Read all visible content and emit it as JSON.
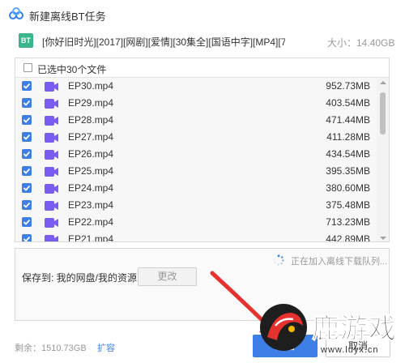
{
  "window": {
    "title": "新建离线BT任务"
  },
  "torrent": {
    "badge": "BT",
    "name": "[你好旧时光][2017][网剧][爱情][30集全][国语中字][MP4][7...",
    "size_text": "大小：14.40GB"
  },
  "list": {
    "select_all_label": "已选中30个文件",
    "rows": [
      {
        "name": "EP30.mp4",
        "size": "952.73MB",
        "checked": true
      },
      {
        "name": "EP29.mp4",
        "size": "403.54MB",
        "checked": true
      },
      {
        "name": "EP28.mp4",
        "size": "471.44MB",
        "checked": true
      },
      {
        "name": "EP27.mp4",
        "size": "411.28MB",
        "checked": true
      },
      {
        "name": "EP26.mp4",
        "size": "434.54MB",
        "checked": true
      },
      {
        "name": "EP25.mp4",
        "size": "395.35MB",
        "checked": true
      },
      {
        "name": "EP24.mp4",
        "size": "380.60MB",
        "checked": true
      },
      {
        "name": "EP23.mp4",
        "size": "375.48MB",
        "checked": true
      },
      {
        "name": "EP22.mp4",
        "size": "713.23MB",
        "checked": true
      },
      {
        "name": "EP21.mp4",
        "size": "442.89MB",
        "checked": true
      }
    ]
  },
  "save": {
    "status_text": "正在加入离线下载队列...",
    "location_label": "保存到: 我的网盘/我的资源",
    "change_label": "更改"
  },
  "footer": {
    "remaining_text": "剩余：1510.73GB",
    "expand_label": "扩容",
    "start_label": "开始",
    "cancel_label": "取消"
  },
  "watermark": {
    "brand": "鹿游戏",
    "url": "www.luyx.cn"
  },
  "colors": {
    "accent": "#3d7fe6",
    "bt_badge": "#3bb58a",
    "video_icon": "#7b5cf0",
    "arrow": "#e6322e"
  }
}
